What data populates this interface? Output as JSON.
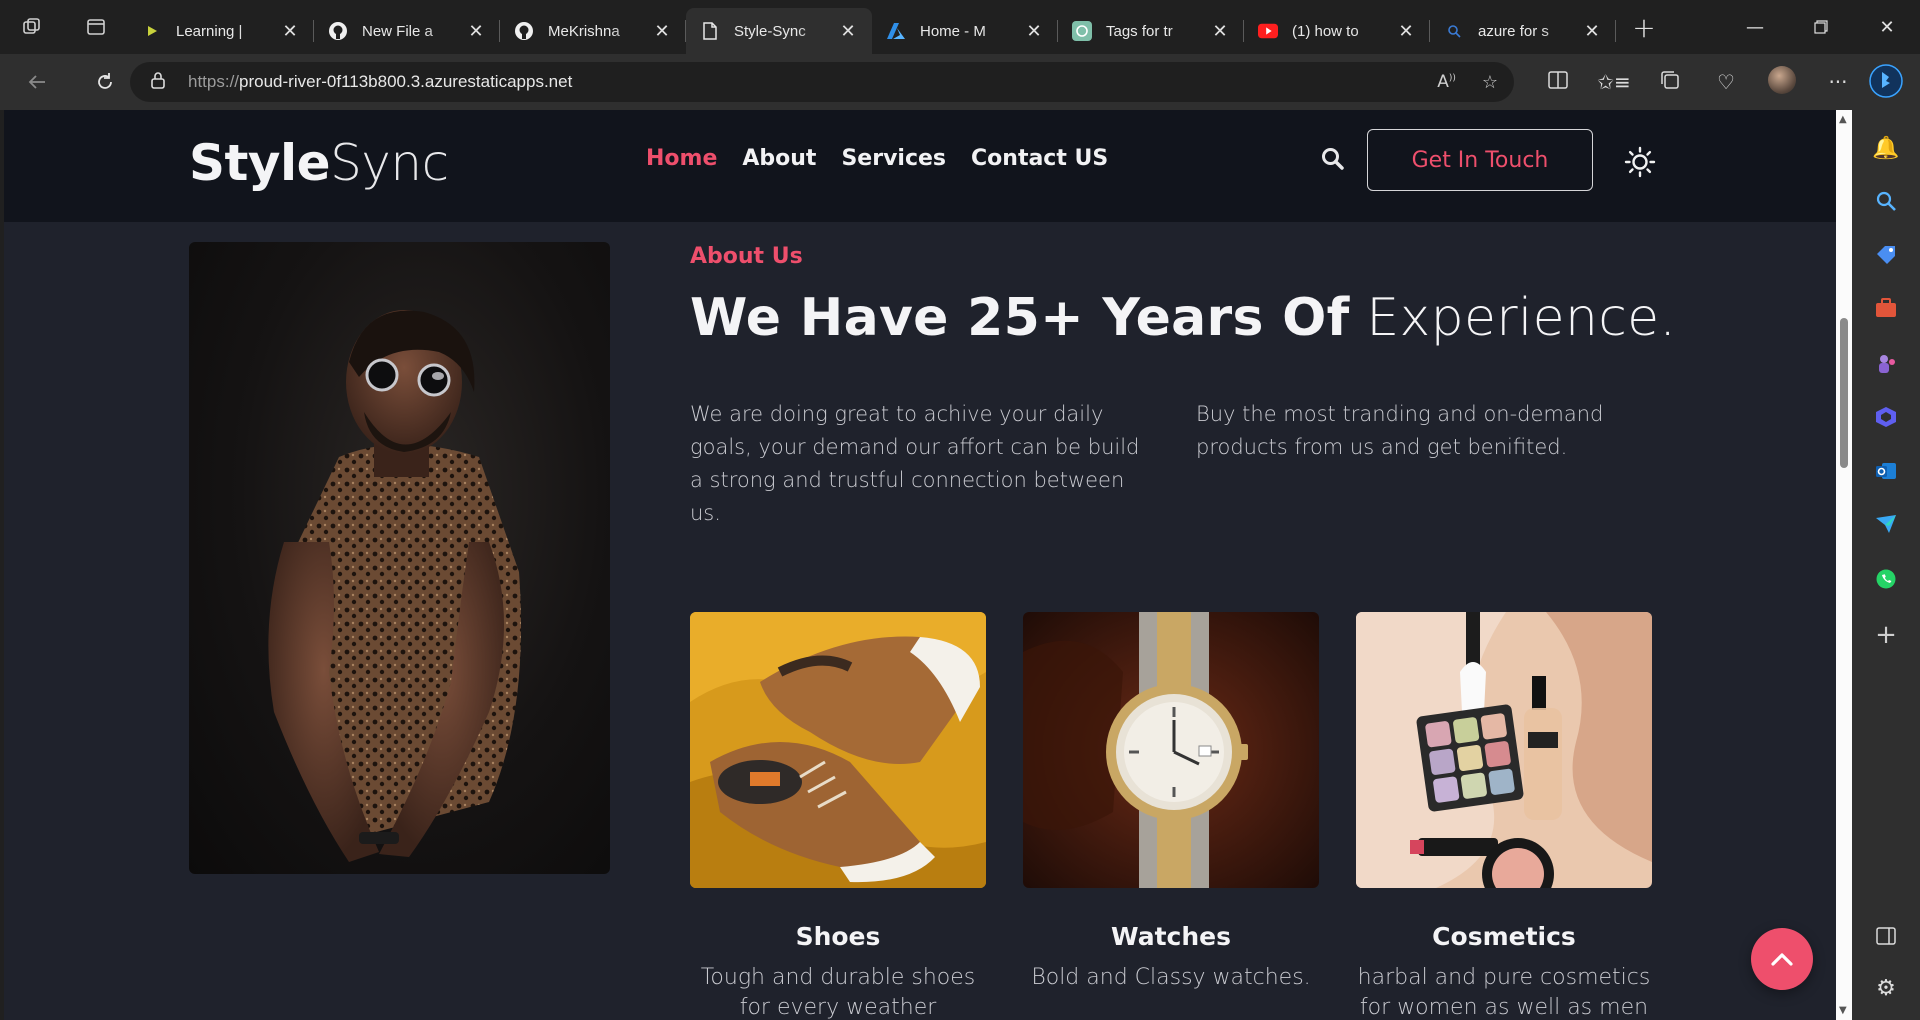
{
  "browser": {
    "tabs": [
      {
        "title": "Learning |",
        "favicon": "learning-play-icon",
        "active": false
      },
      {
        "title": "New File a",
        "favicon": "github-icon",
        "active": false
      },
      {
        "title": "MeKrishna",
        "favicon": "github-icon",
        "active": false
      },
      {
        "title": "Style-Sync",
        "favicon": "page-icon",
        "active": true
      },
      {
        "title": "Home - M",
        "favicon": "azure-icon",
        "active": false
      },
      {
        "title": "Tags for tr",
        "favicon": "chatgpt-icon",
        "active": false
      },
      {
        "title": "(1) how to",
        "favicon": "youtube-icon",
        "active": false
      },
      {
        "title": "azure for s",
        "favicon": "search-icon",
        "active": false
      }
    ],
    "address": {
      "scheme": "https://",
      "host": "proud-river-0f113b800.3.azurestaticapps.net"
    }
  },
  "site": {
    "logo_bold": "Style",
    "logo_light": "Sync",
    "nav": [
      {
        "label": "Home",
        "active": true
      },
      {
        "label": "About",
        "active": false
      },
      {
        "label": "Services",
        "active": false
      },
      {
        "label": "Contact US",
        "active": false
      }
    ],
    "cta_label": "Get In Touch",
    "about": {
      "kicker": "About Us",
      "headline_bold": "We Have 25+ Years Of",
      "headline_light": "Experience.",
      "para1": "We are doing great to achive your daily goals, your demand our affort can be build a strong and trustful connection between us.",
      "para2": "Buy the most tranding and on-demand products from us and get benifited."
    },
    "cards": [
      {
        "title": "Shoes",
        "desc": "Tough and durable shoes for every weather"
      },
      {
        "title": "Watches",
        "desc": "Bold and Classy watches."
      },
      {
        "title": "Cosmetics",
        "desc": "harbal and pure cosmetics for women as well as men"
      }
    ]
  },
  "colors": {
    "accent": "#ee4f6c",
    "header_bg": "#11141c",
    "page_bg": "#1f222c"
  }
}
